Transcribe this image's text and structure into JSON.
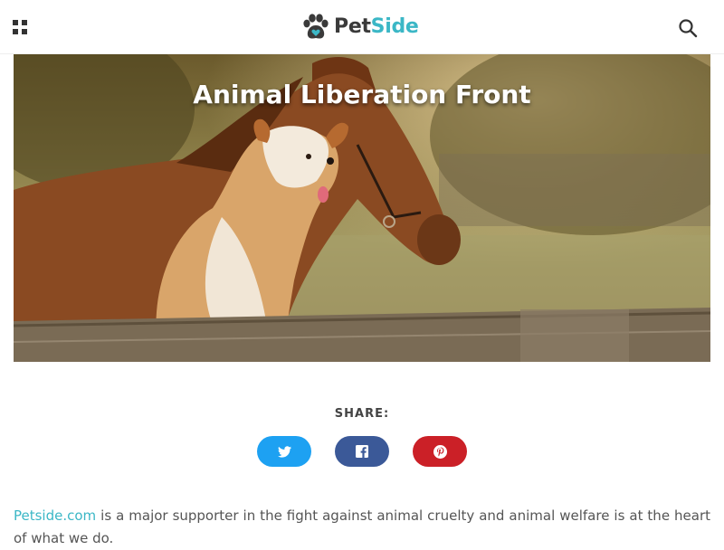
{
  "header": {
    "logo_pet": "Pet",
    "logo_side": "Side",
    "icons": {
      "menu": "grid-menu-icon",
      "search": "search-icon",
      "logo": "paw-heart-icon"
    },
    "colors": {
      "brand_dark": "#3a3a3a",
      "brand_accent": "#3bb7c6"
    }
  },
  "hero": {
    "title": "Animal Liberation Front"
  },
  "share": {
    "label": "SHARE:",
    "buttons": [
      {
        "network": "twitter",
        "icon": "twitter-icon",
        "color": "#1da1f2"
      },
      {
        "network": "facebook",
        "icon": "facebook-icon",
        "color": "#3b5998"
      },
      {
        "network": "pinterest",
        "icon": "pinterest-icon",
        "color": "#cb2027"
      }
    ]
  },
  "article": {
    "link_text": "Petside.com",
    "intro_text": " is a major supporter in the fight against animal cruelty and animal welfare is at the heart of what we do."
  }
}
